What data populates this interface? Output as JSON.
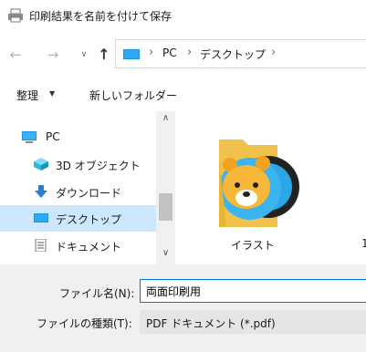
{
  "window": {
    "title": "印刷結果を名前を付けて保存"
  },
  "nav": {
    "back_icon": "arrow-left-icon",
    "forward_icon": "arrow-right-icon",
    "recent_icon": "chevron-down-icon",
    "up_icon": "arrow-up-icon",
    "up_glyph": "↑",
    "back_glyph": "←",
    "forward_glyph": "→",
    "recent_glyph": "∨"
  },
  "address": {
    "separator": "›",
    "crumbs": [
      "PC",
      "デスクトップ"
    ]
  },
  "toolbar": {
    "organize_label": "整理",
    "organize_caret": "▼",
    "new_folder_label": "新しいフォルダー"
  },
  "sidebar": {
    "items": [
      {
        "label": "PC",
        "icon": "pc-icon"
      },
      {
        "label": "3D オブジェクト",
        "icon": "3d-objects-icon"
      },
      {
        "label": "ダウンロード",
        "icon": "download-icon"
      },
      {
        "label": "デスクトップ",
        "icon": "desktop-icon",
        "selected": true
      },
      {
        "label": "ドキュメント",
        "icon": "document-icon"
      }
    ],
    "scroll_up_glyph": "∧",
    "scroll_down_glyph": "∨"
  },
  "content": {
    "items": [
      {
        "label": "イラスト",
        "icon": "folder-icon"
      },
      {
        "label": "1"
      }
    ]
  },
  "save_panel": {
    "filename_label": "ファイル名(N):",
    "filename_value": "両面印刷用",
    "filetype_label": "ファイルの種類(T):",
    "filetype_value": "PDF ドキュメント (*.pdf)"
  },
  "colors": {
    "selection": "#cce8ff",
    "accent": "#0078d7",
    "bottom_panel": "#f0f0f0"
  }
}
